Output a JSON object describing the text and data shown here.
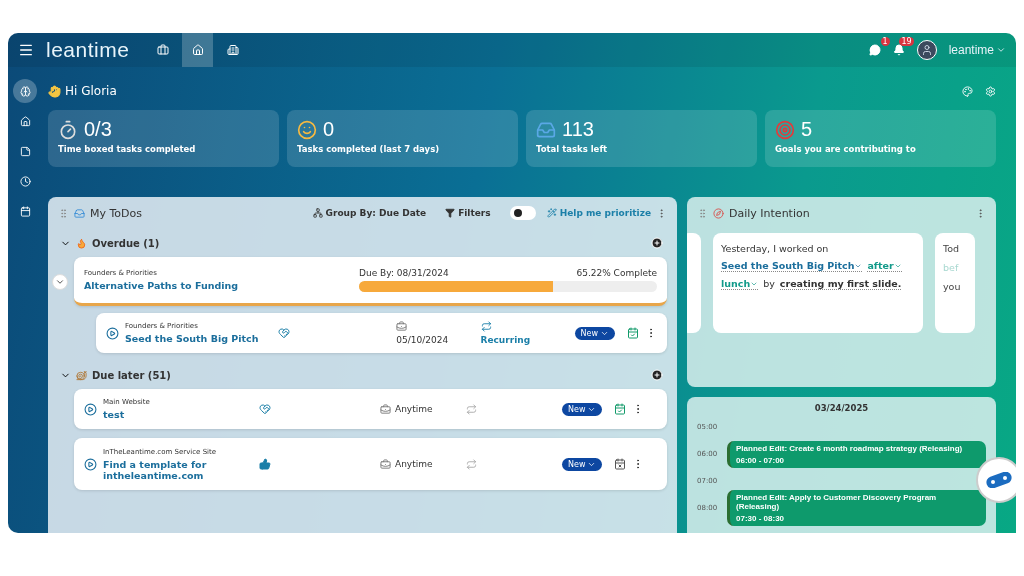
{
  "header": {
    "logo": "leantime",
    "nav": [
      {
        "kind": "briefcase",
        "selected": false
      },
      {
        "kind": "home",
        "selected": true
      },
      {
        "kind": "building",
        "selected": false
      }
    ],
    "notifications": [
      {
        "kind": "chat",
        "count": "1"
      },
      {
        "kind": "bell",
        "count": "19"
      }
    ],
    "user": "leantime"
  },
  "sidebar": {
    "items": [
      {
        "kind": "brain",
        "selected": true
      },
      {
        "kind": "home",
        "selected": false
      },
      {
        "kind": "note",
        "selected": false
      },
      {
        "kind": "clock",
        "selected": false
      },
      {
        "kind": "calendar",
        "selected": false
      }
    ]
  },
  "greeting": "Hi Gloria",
  "stats": [
    {
      "kind": "timer",
      "value": "0/3",
      "label": "Time boxed tasks completed"
    },
    {
      "kind": "smile",
      "value": "0",
      "label": "Tasks completed (last 7 days)"
    },
    {
      "kind": "inbox",
      "value": "113",
      "label": "Total tasks left"
    },
    {
      "kind": "target",
      "value": "5",
      "label": "Goals you are contributing to"
    }
  ],
  "todos": {
    "title": "My ToDos",
    "group_by": "Group By: Due Date",
    "filters": "Filters",
    "toggle": {
      "on": false
    },
    "prioritize": "Help me prioritize",
    "groups": [
      {
        "kind": "fire",
        "title": "Overdue (1)",
        "expanded": true,
        "milestone": {
          "project": "Founders & Priorities",
          "title": "Alternative Paths to Funding",
          "due": "Due By: 08/31/2024",
          "complete": "65.22% Complete",
          "level": 0.6522,
          "expanded": true
        },
        "tasks": [
          {
            "project": "Founders & Priorities",
            "title": "Seed the South Big Pitch",
            "kind": "heart",
            "date": "05/10/2024",
            "recurring": true,
            "recurring_label": "Recurring",
            "status": "New",
            "scheduled": true
          }
        ]
      },
      {
        "kind": "snail",
        "title": "Due later (51)",
        "expanded": true,
        "tasks": [
          {
            "project": "Main Website",
            "title": "test",
            "kind": "heart",
            "date": "Anytime",
            "recurring": false,
            "status": "New",
            "scheduled": true
          },
          {
            "project": "InTheLeantime.com Service Site",
            "title": "Find a template for intheleantime.com",
            "kind": "thumb",
            "date": "Anytime",
            "recurring": false,
            "status": "New",
            "scheduled": false
          }
        ]
      }
    ]
  },
  "intention": {
    "title": "Daily Intention",
    "sentence": [
      {
        "kind": "text",
        "text": "Yesterday, I worked on"
      },
      {
        "kind": "link",
        "text": "Seed the South Big Pitch"
      },
      {
        "kind": "pick",
        "text": "after"
      },
      {
        "kind": "pick",
        "text": "lunch"
      },
      {
        "kind": "text",
        "text": "by"
      },
      {
        "kind": "bold",
        "text": "creating my first slide."
      }
    ],
    "next_card": [
      "Tod",
      "bef",
      "you"
    ]
  },
  "calendar": {
    "date": "03/24/2025",
    "hours": [
      "05:00",
      "06:00",
      "07:00",
      "08:00"
    ],
    "events": [
      {
        "title": "Planned Edit: Create 6 month roadmap strategy (Releasing)",
        "time": "06:00 - 07:00"
      },
      {
        "title": "Planned Edit: Apply to Customer Discovery Program (Releasing)",
        "time": "07:30 - 08:30"
      }
    ]
  }
}
